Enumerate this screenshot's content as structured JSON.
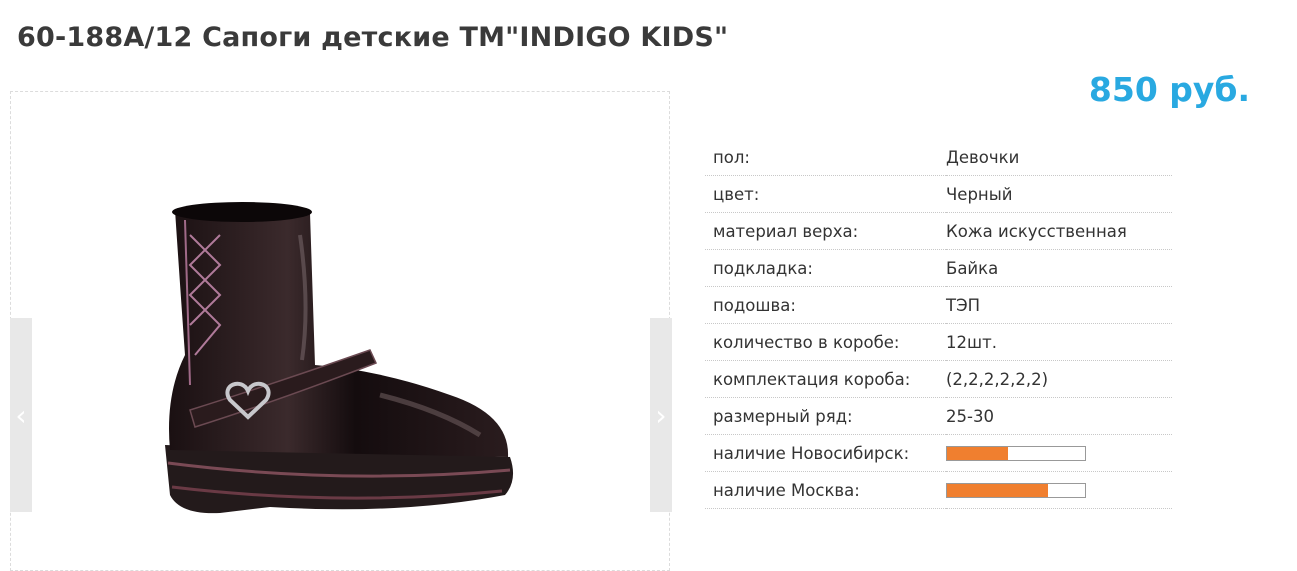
{
  "product": {
    "title": "60-188A/12 Сапоги детские ТМ\"INDIGO KIDS\"",
    "price": "850 руб."
  },
  "gallery": {
    "prev_icon": "chevron-left-icon",
    "next_icon": "chevron-right-icon",
    "prev_glyph": "‹",
    "next_glyph": "›",
    "image": "black-patent-boot-with-heart-buckle"
  },
  "specs": [
    {
      "label": "пол:",
      "value": "Девочки"
    },
    {
      "label": "цвет:",
      "value": "Черный"
    },
    {
      "label": "материал верха:",
      "value": "Кожа искусственная"
    },
    {
      "label": "подкладка:",
      "value": "Байка"
    },
    {
      "label": "подошва:",
      "value": "ТЭП"
    },
    {
      "label": "количество в коробе:",
      "value": "12шт."
    },
    {
      "label": "комплектация короба:",
      "value": "(2,2,2,2,2,2)"
    },
    {
      "label": "размерный ряд:",
      "value": "25-30"
    }
  ],
  "availability": [
    {
      "label": "наличие Новосибирск:",
      "level": 0.44
    },
    {
      "label": "наличие Москва:",
      "level": 0.73
    }
  ],
  "colors": {
    "price": "#29a9e1",
    "bar_fill": "#f07f2f"
  }
}
